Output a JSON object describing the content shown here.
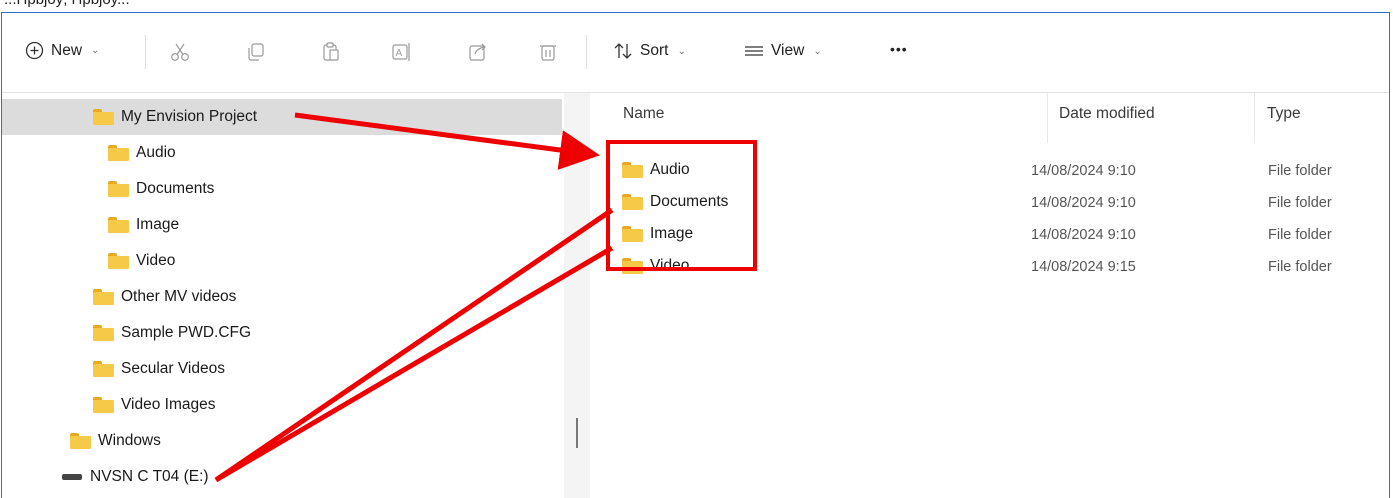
{
  "page_header": "...Hpbjoy; Hpbjoy...",
  "toolbar": {
    "new_label": "New",
    "sort_label": "Sort",
    "view_label": "View",
    "more_label": "•••"
  },
  "nav": {
    "items": [
      {
        "label": "My Envision Project",
        "type": "folder",
        "indent": 1,
        "selected": true
      },
      {
        "label": "Audio",
        "type": "folder",
        "indent": 2
      },
      {
        "label": "Documents",
        "type": "folder",
        "indent": 2
      },
      {
        "label": "Image",
        "type": "folder",
        "indent": 2
      },
      {
        "label": "Video",
        "type": "folder",
        "indent": 2
      },
      {
        "label": "Other MV videos",
        "type": "folder",
        "indent": 1
      },
      {
        "label": "Sample PWD.CFG",
        "type": "folder",
        "indent": 1
      },
      {
        "label": "Secular Videos",
        "type": "folder",
        "indent": 1
      },
      {
        "label": "Video Images",
        "type": "folder",
        "indent": 1
      },
      {
        "label": "Windows",
        "type": "folder",
        "indent": 0
      },
      {
        "label": "NVSN C T04 (E:)",
        "type": "drive",
        "indent": 0
      }
    ]
  },
  "file_list": {
    "columns": {
      "name": "Name",
      "date": "Date modified",
      "type": "Type"
    },
    "rows": [
      {
        "name": "Audio",
        "date": "14/08/2024 9:10",
        "type": "File folder"
      },
      {
        "name": "Documents",
        "date": "14/08/2024 9:10",
        "type": "File folder"
      },
      {
        "name": "Image",
        "date": "14/08/2024 9:10",
        "type": "File folder"
      },
      {
        "name": "Video",
        "date": "14/08/2024 9:15",
        "type": "File folder"
      }
    ]
  },
  "colors": {
    "window_border": "#2f6fd1",
    "selection": "#dcdcdc",
    "annotation_red": "#ee0000",
    "folder_yellow": "#f7c948"
  }
}
